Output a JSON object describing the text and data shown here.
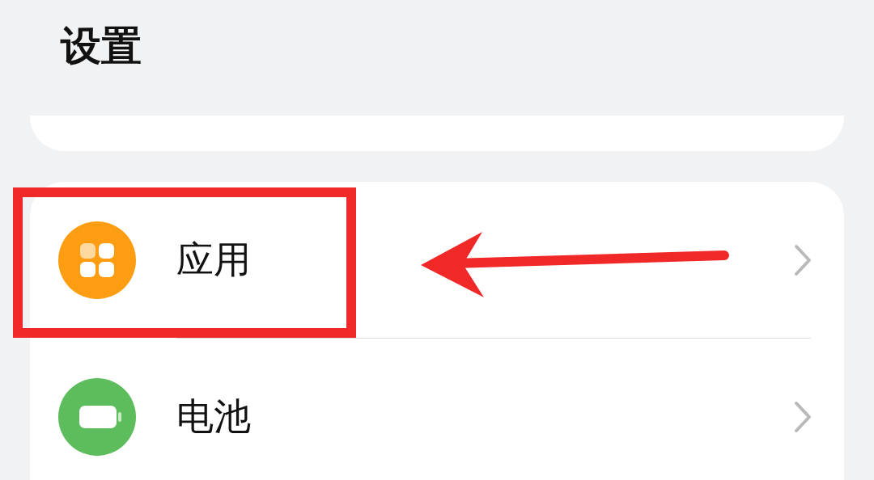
{
  "title": "设置",
  "items": [
    {
      "label": "应用",
      "kind": "apps"
    },
    {
      "label": "电池",
      "kind": "battery"
    }
  ]
}
